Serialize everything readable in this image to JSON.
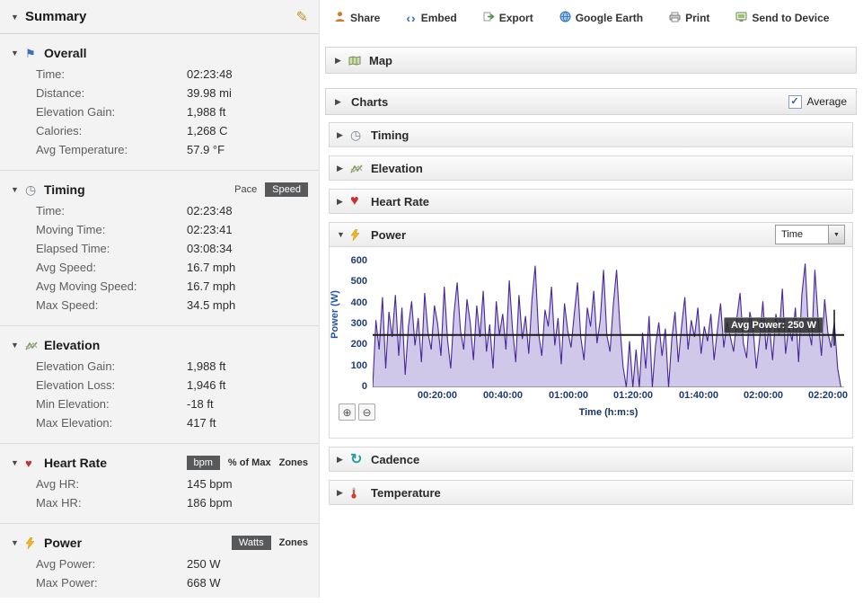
{
  "icons": {
    "edit": "✎",
    "expanded": "▼",
    "collapsed": "▶",
    "flag": "⚑",
    "clock": "◷",
    "heart": "♥",
    "cadence": "↻",
    "embed": "‹›",
    "zoom_in": "⊕",
    "zoom_out": "⊖",
    "dropdown_arrow": "▼",
    "check": "✓"
  },
  "sidebar": {
    "title": "Summary",
    "sections": [
      {
        "title": "Overall",
        "rows": [
          {
            "label": "Time:",
            "value": "02:23:48"
          },
          {
            "label": "Distance:",
            "value": "39.98 mi"
          },
          {
            "label": "Elevation Gain:",
            "value": "1,988 ft"
          },
          {
            "label": "Calories:",
            "value": "1,268 C"
          },
          {
            "label": "Avg Temperature:",
            "value": "57.9 °F"
          }
        ]
      },
      {
        "title": "Timing",
        "toggle": {
          "options": [
            "Pace",
            "Speed"
          ],
          "selected": "Speed"
        },
        "rows": [
          {
            "label": "Time:",
            "value": "02:23:48"
          },
          {
            "label": "Moving Time:",
            "value": "02:23:41"
          },
          {
            "label": "Elapsed Time:",
            "value": "03:08:34"
          },
          {
            "label": "Avg Speed:",
            "value": "16.7 mph"
          },
          {
            "label": "Avg Moving Speed:",
            "value": "16.7 mph"
          },
          {
            "label": "Max Speed:",
            "value": "34.5 mph"
          }
        ]
      },
      {
        "title": "Elevation",
        "rows": [
          {
            "label": "Elevation Gain:",
            "value": "1,988 ft"
          },
          {
            "label": "Elevation Loss:",
            "value": "1,946 ft"
          },
          {
            "label": "Min Elevation:",
            "value": "-18 ft"
          },
          {
            "label": "Max Elevation:",
            "value": "417 ft"
          }
        ]
      },
      {
        "title": "Heart Rate",
        "badges": {
          "unit": "bpm",
          "links": [
            "% of Max",
            "Zones"
          ]
        },
        "rows": [
          {
            "label": "Avg HR:",
            "value": "145 bpm"
          },
          {
            "label": "Max HR:",
            "value": "186 bpm"
          }
        ]
      },
      {
        "title": "Power",
        "badges": {
          "unit": "Watts",
          "links": [
            "Zones"
          ]
        },
        "rows": [
          {
            "label": "Avg Power:",
            "value": "250 W"
          },
          {
            "label": "Max Power:",
            "value": "668 W"
          }
        ]
      }
    ]
  },
  "toolbar": {
    "items": [
      {
        "label": "Share"
      },
      {
        "label": "Embed"
      },
      {
        "label": "Export"
      },
      {
        "label": "Google Earth"
      },
      {
        "label": "Print"
      },
      {
        "label": "Send to Device"
      }
    ]
  },
  "panels": {
    "map": {
      "title": "Map"
    },
    "charts": {
      "title": "Charts",
      "average_label": "Average",
      "average_checked": true
    },
    "sub": [
      {
        "title": "Timing"
      },
      {
        "title": "Elevation"
      },
      {
        "title": "Heart Rate"
      },
      {
        "title": "Power",
        "expanded": true,
        "dropdown_value": "Time"
      },
      {
        "title": "Cadence"
      },
      {
        "title": "Temperature"
      }
    ]
  },
  "chart_data": {
    "type": "line",
    "title": "Power",
    "xlabel": "Time (h:m:s)",
    "ylabel": "Power (W)",
    "ylim": [
      0,
      600
    ],
    "y_ticks": [
      0,
      100,
      200,
      300,
      400,
      500,
      600
    ],
    "x_tick_labels": [
      "00:20:00",
      "00:40:00",
      "01:00:00",
      "01:20:00",
      "01:40:00",
      "02:00:00",
      "02:20:00"
    ],
    "x_tick_seconds": [
      1200,
      2400,
      3600,
      4800,
      6000,
      7200,
      8400
    ],
    "x_range_seconds": [
      0,
      8700
    ],
    "x_step_seconds": 60,
    "grid": false,
    "legend": "none",
    "series": [
      {
        "name": "Power",
        "values": [
          0,
          320,
          180,
          430,
          90,
          360,
          240,
          440,
          150,
          380,
          60,
          290,
          410,
          200,
          330,
          120,
          450,
          260,
          180,
          390,
          300,
          150,
          480,
          230,
          90,
          350,
          500,
          270,
          180,
          420,
          310,
          130,
          390,
          240,
          460,
          170,
          300,
          90,
          410,
          250,
          350,
          180,
          510,
          280,
          120,
          440,
          230,
          340,
          160,
          420,
          580,
          260,
          150,
          370,
          290,
          480,
          200,
          330,
          110,
          400,
          270,
          190,
          350,
          500,
          240,
          130,
          380,
          290,
          460,
          210,
          320,
          560,
          250,
          170,
          390,
          560,
          300,
          100,
          0,
          220,
          0,
          180,
          0,
          260,
          90,
          340,
          0,
          200,
          310,
          150,
          280,
          0,
          230,
          360,
          120,
          290,
          430,
          180,
          320,
          240,
          380,
          160,
          290,
          220,
          350,
          130,
          270,
          400,
          190,
          310,
          240,
          170,
          330,
          450,
          210,
          140,
          360,
          280,
          90,
          230,
          410,
          180,
          300,
          130,
          350,
          250,
          470,
          160,
          290,
          220,
          380,
          120,
          440,
          590,
          280,
          200,
          560,
          330,
          150,
          420,
          260,
          190,
          310,
          90,
          0
        ]
      }
    ],
    "average": {
      "value": 250,
      "label": "Avg Power: 250 W"
    },
    "line_color": "#47279b",
    "fill_color": "rgba(120,98,190,0.35)",
    "avg_line_color": "#1a1a1a"
  }
}
